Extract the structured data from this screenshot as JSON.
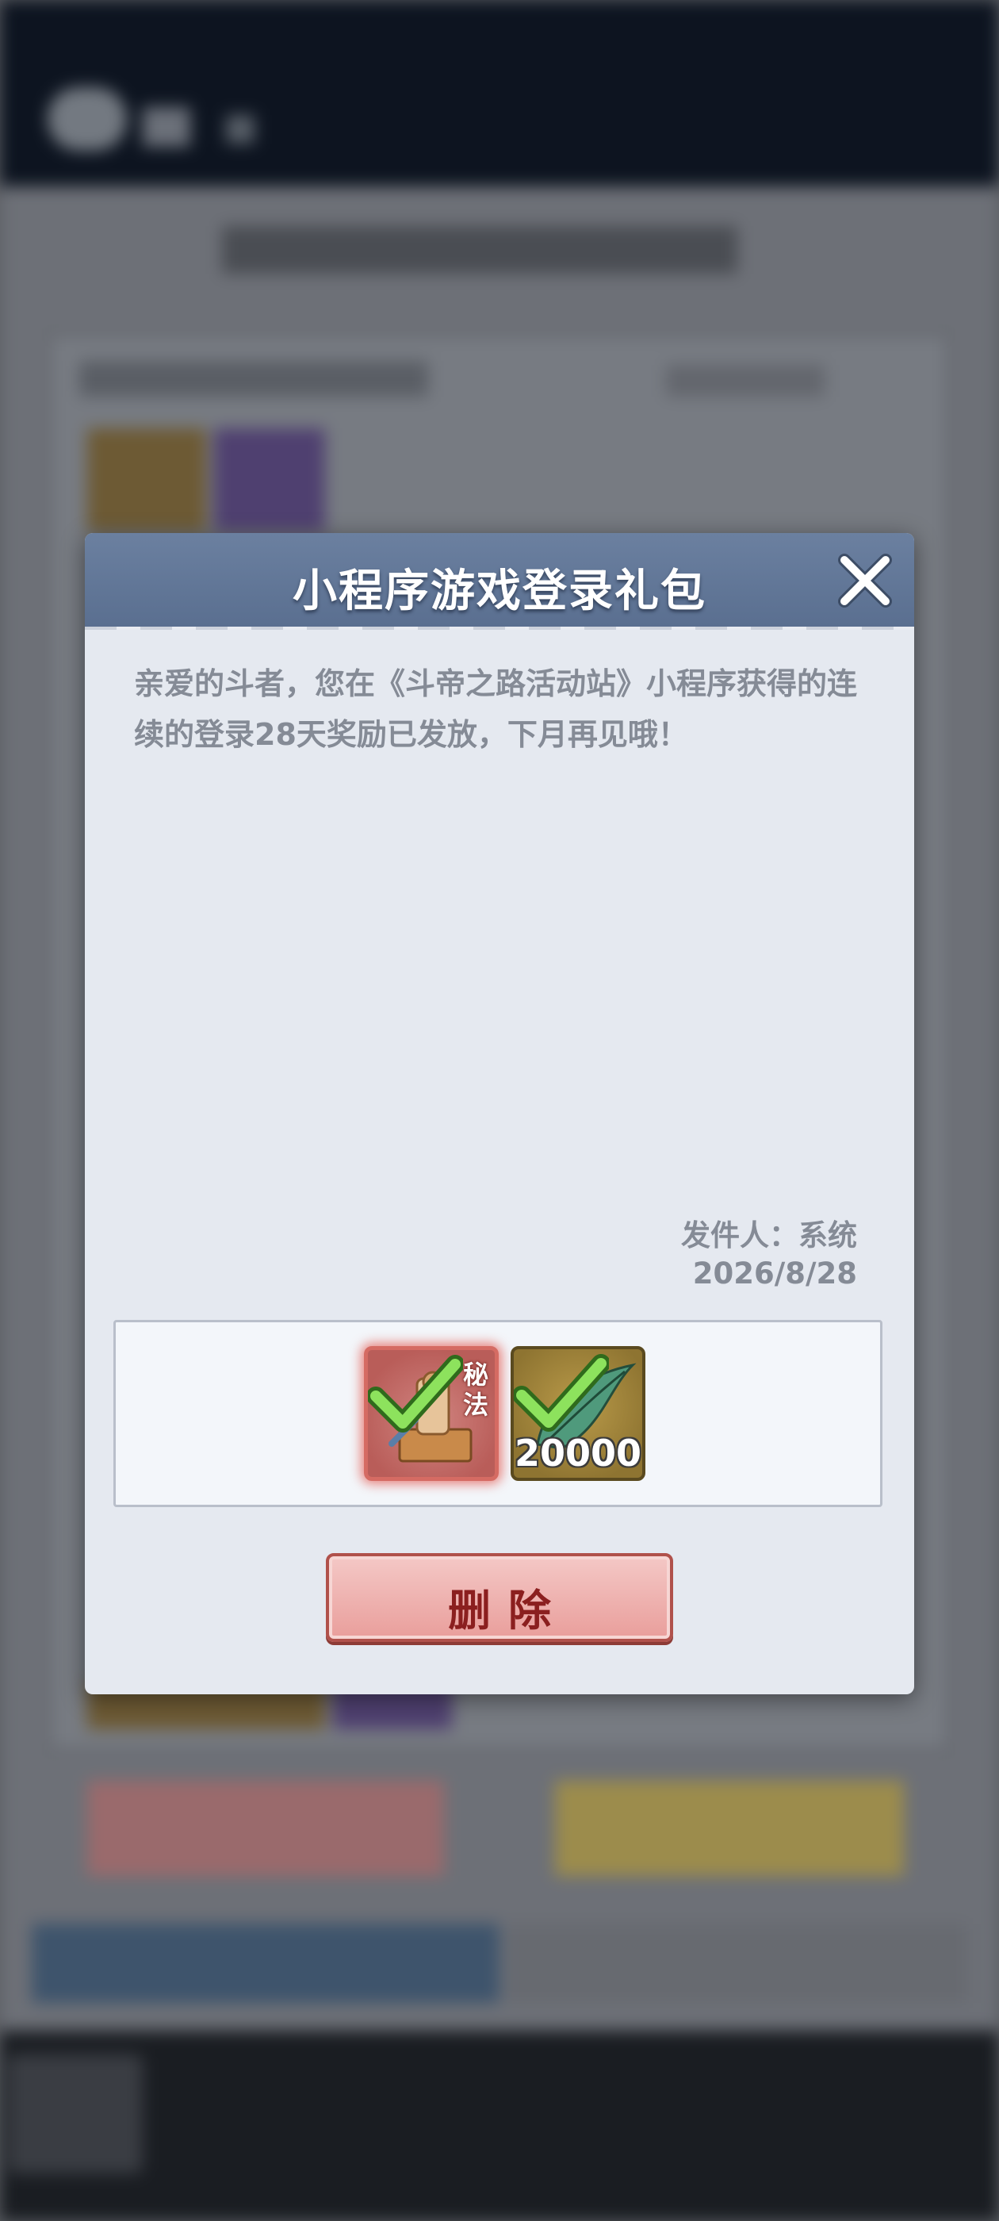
{
  "modal": {
    "title": "小程序游戏登录礼包",
    "body": "亲爱的斗者，您在《斗帝之路活动站》小程序获得的连续的登录28天奖励已发放，下月再见哦！",
    "sender": "发件人：系统",
    "date": "2026/8/28",
    "rewards": [
      {
        "icon": "secret-scroll-icon",
        "tag": "秘法",
        "claimed": true,
        "rarity_color": "#d56b63"
      },
      {
        "icon": "green-feather-icon",
        "quantity": "20000",
        "claimed": true,
        "rarity_color": "#8e7431"
      }
    ],
    "delete_label": "删除"
  },
  "colors": {
    "header": "#5a6f90",
    "panel": "#e5e9f0",
    "body_text": "#858b96",
    "delete_text": "#8b1f1f",
    "check": "#7ed957"
  }
}
